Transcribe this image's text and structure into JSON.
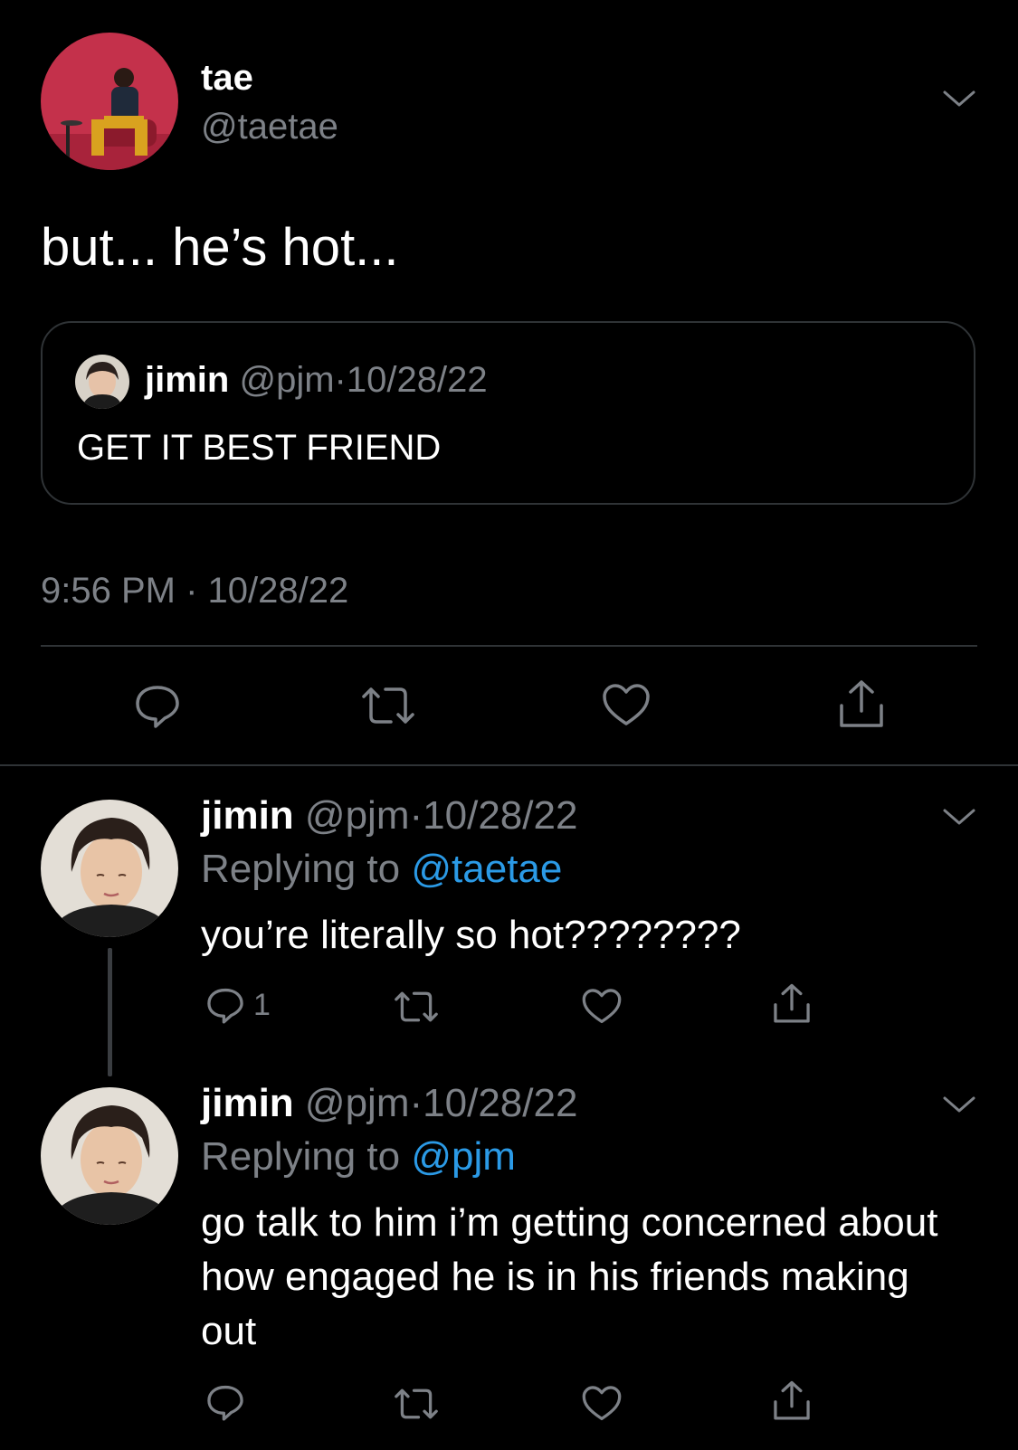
{
  "main_tweet": {
    "name": "tae",
    "handle": "@taetae",
    "text": "but... he’s hot...",
    "timestamp": "9:56 PM · 10/28/22",
    "quoted": {
      "name": "jimin",
      "handle": "@pjm",
      "separator": "·",
      "date": "10/28/22",
      "text": "GET IT BEST FRIEND"
    },
    "actions": {
      "reply_icon": "reply-icon",
      "retweet_icon": "retweet-icon",
      "like_icon": "like-icon",
      "share_icon": "share-icon"
    }
  },
  "replies": [
    {
      "name": "jimin",
      "handle": "@pjm",
      "separator": "·",
      "date": "10/28/22",
      "replying_prefix": "Replying to",
      "replying_to": "@taetae",
      "text": "you’re literally so hot????????",
      "reply_count": "1"
    },
    {
      "name": "jimin",
      "handle": "@pjm",
      "separator": "·",
      "date": "10/28/22",
      "replying_prefix": "Replying to",
      "replying_to": "@pjm",
      "text": "go talk to him i’m getting concerned about how engaged he is in his friends making out",
      "reply_count": ""
    }
  ],
  "colors": {
    "background": "#000000",
    "text": "#ffffff",
    "secondary": "#7d8187",
    "link": "#2b9ae6",
    "divider": "#2f3336"
  }
}
